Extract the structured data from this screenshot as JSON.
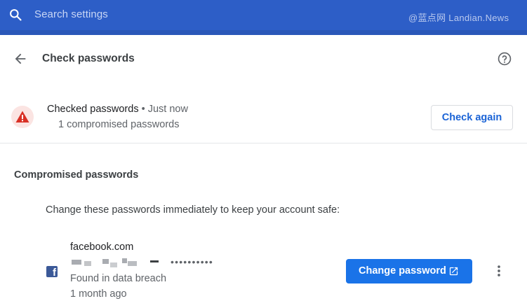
{
  "header": {
    "search_placeholder": "Search settings",
    "watermark": "@蓝点网 Landian.News",
    "bar_color": "#2d5ec7"
  },
  "page": {
    "title": "Check passwords",
    "icons": {
      "back": "arrow-back-icon",
      "help": "help-icon"
    }
  },
  "status": {
    "title": "Checked passwords",
    "separator": " • ",
    "time": "Just now",
    "summary": "1 compromised passwords",
    "check_again_label": "Check again",
    "warning_icon": "warning-icon",
    "warning_color": "#d93025"
  },
  "compromised": {
    "section_title": "Compromised passwords",
    "description": "Change these passwords immediately to keep your account safe:",
    "entries": [
      {
        "site": "facebook.com",
        "site_icon": "facebook-icon",
        "password_mask": "••••••••••",
        "reason": "Found in data breach",
        "age": "1 month ago",
        "action_label": "Change password",
        "action_icon": "open-in-new-icon",
        "more_icon": "more-vert-icon"
      }
    ]
  },
  "colors": {
    "accent": "#1a73e8",
    "text_secondary": "#5f6368"
  }
}
